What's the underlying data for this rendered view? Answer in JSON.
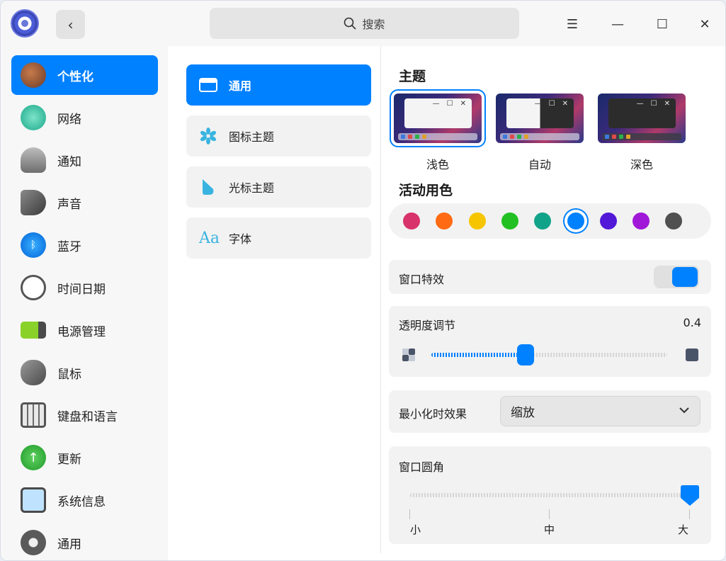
{
  "titlebar": {
    "search_placeholder": "搜索",
    "menu_icon": "☰",
    "minimize_icon": "—",
    "maximize_icon": "☐",
    "close_icon": "✕",
    "back_icon": "‹"
  },
  "sidebar": {
    "items": [
      {
        "label": "个性化",
        "icon": "palette-icon",
        "active": true
      },
      {
        "label": "网络",
        "icon": "network-icon"
      },
      {
        "label": "通知",
        "icon": "bell-icon"
      },
      {
        "label": "声音",
        "icon": "speaker-icon"
      },
      {
        "label": "蓝牙",
        "icon": "bluetooth-icon"
      },
      {
        "label": "时间日期",
        "icon": "clock-icon"
      },
      {
        "label": "电源管理",
        "icon": "battery-icon"
      },
      {
        "label": "鼠标",
        "icon": "mouse-icon"
      },
      {
        "label": "键盘和语言",
        "icon": "keyboard-icon"
      },
      {
        "label": "更新",
        "icon": "update-icon"
      },
      {
        "label": "系统信息",
        "icon": "system-info-icon"
      },
      {
        "label": "通用",
        "icon": "general-icon"
      }
    ]
  },
  "middle": {
    "items": [
      {
        "label": "通用",
        "icon": "window-icon",
        "active": true
      },
      {
        "label": "图标主题",
        "icon": "icon-theme-icon"
      },
      {
        "label": "光标主题",
        "icon": "cursor-icon"
      },
      {
        "label": "字体",
        "icon": "font-icon",
        "glyph": "Aa"
      }
    ]
  },
  "content": {
    "theme_title": "主题",
    "themes": [
      {
        "label": "浅色",
        "selected": true
      },
      {
        "label": "自动"
      },
      {
        "label": "深色"
      }
    ],
    "accent_title": "活动用色",
    "accent_colors": [
      "#d8336a",
      "#ff6a13",
      "#f7c500",
      "#22c022",
      "#11a38a",
      "#0081ff",
      "#5218d8",
      "#a017d8",
      "#505050"
    ],
    "accent_selected_index": 5,
    "window_effect_label": "窗口特效",
    "window_effect_on": true,
    "transparency_label": "透明度调节",
    "transparency_value": "0.4",
    "transparency_level": 0.4,
    "minimize_label": "最小化时效果",
    "minimize_value": "缩放",
    "corner_label": "窗口圆角",
    "corner_ticks": [
      "小",
      "中",
      "大"
    ],
    "corner_level": 1.0
  }
}
